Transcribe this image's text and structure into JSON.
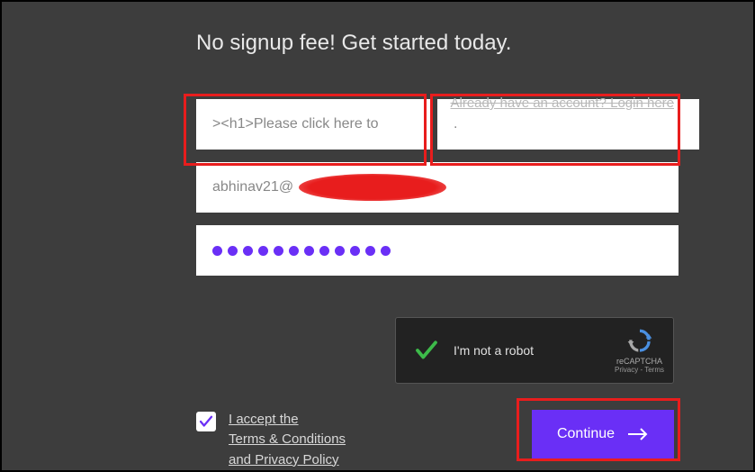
{
  "heading": "No signup fee! Get started today.",
  "login_prompt": "Already have an account? Login here",
  "form": {
    "first_name_value": "><h1>Please click here to",
    "last_name_value": ".",
    "email_value": "abhinav21@",
    "password_dot_count": 12
  },
  "captcha": {
    "label": "I'm not a robot",
    "badge": "reCAPTCHA",
    "legal": "Privacy - Terms",
    "checked": true
  },
  "terms": {
    "checked": true,
    "text_line1": "I accept the",
    "text_line2": "Terms & Conditions",
    "text_line3": "and Privacy Policy"
  },
  "continue_label": "Continue",
  "colors": {
    "accent": "#6a2ff6",
    "highlight": "#e81d1d"
  }
}
